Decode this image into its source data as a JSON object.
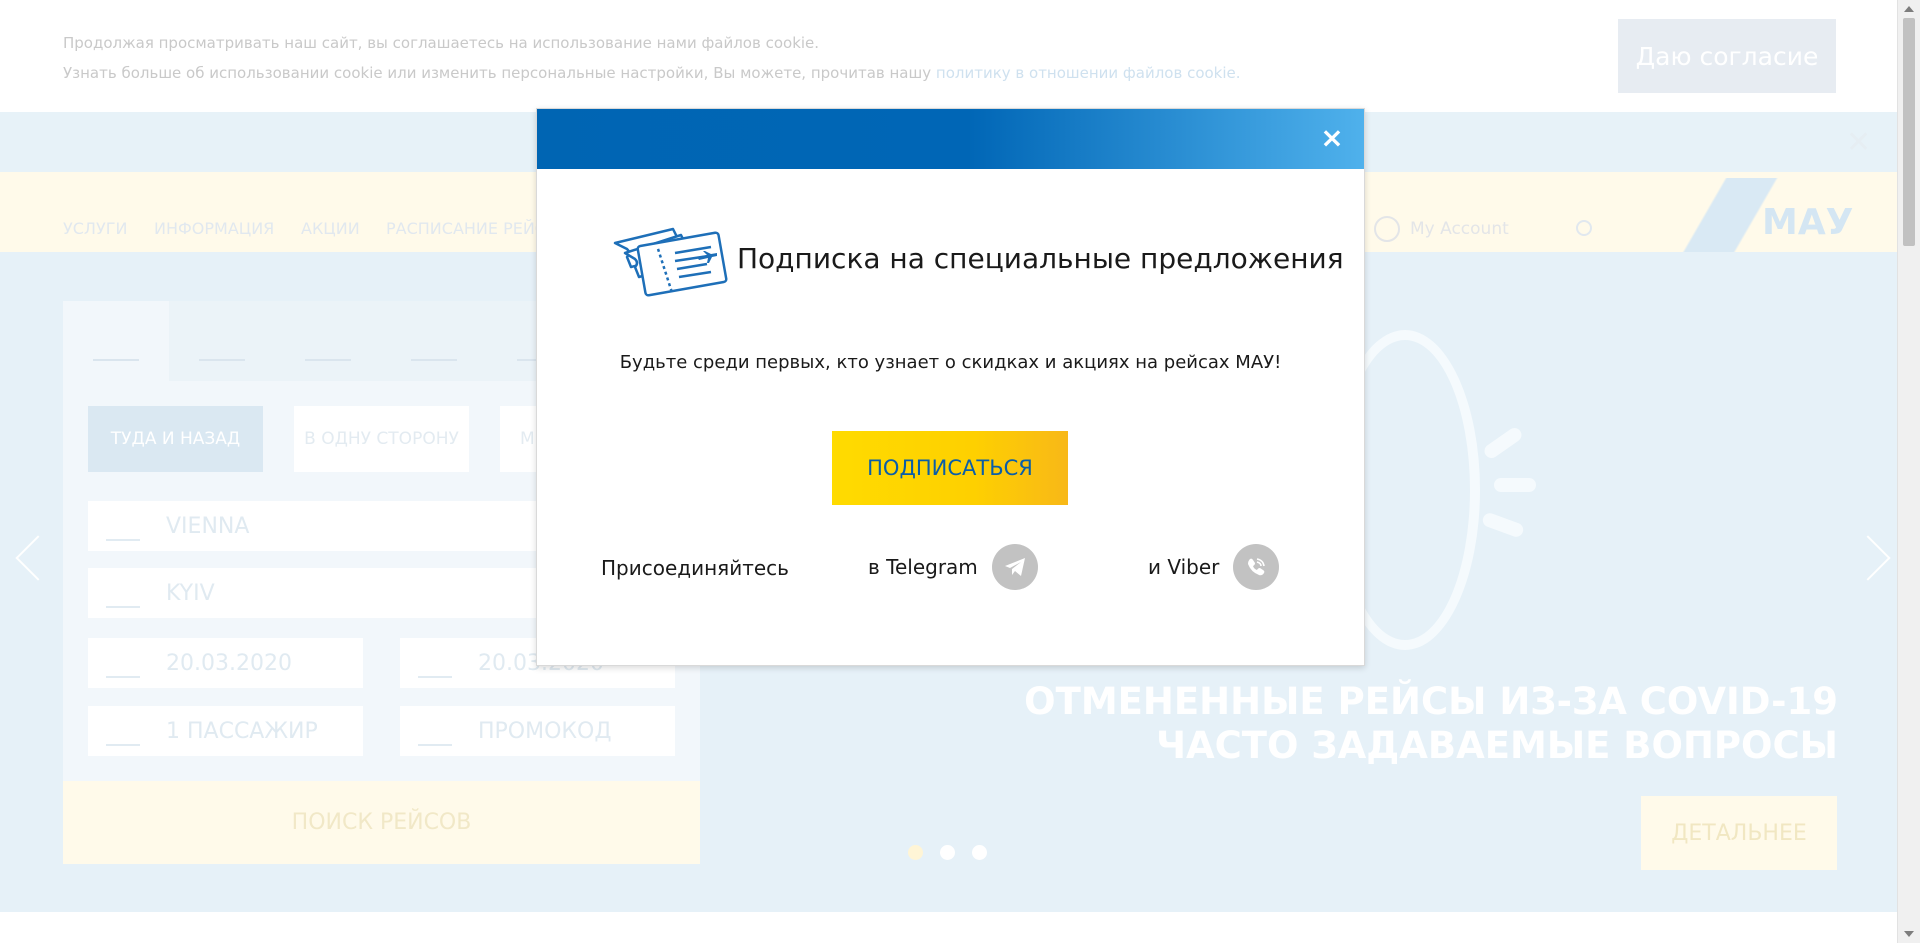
{
  "cookie": {
    "line1": "Продолжая просматривать наш сайт, вы соглашаетесь на использование нами файлов cookie.",
    "line2_prefix": "Узнать больше об использовании cookie или изменить персональные настройки, Вы можете, прочитав нашу",
    "line2_link": "политику в отношении файлов cookie.",
    "consent_button": "Даю согласие"
  },
  "nav": {
    "items": [
      "УСЛУГИ",
      "ИНФОРМАЦИЯ",
      "АКЦИИ",
      "РАСПИСАНИЕ РЕЙСОВ"
    ],
    "account_label": "My Account",
    "logo_text": "МАУ"
  },
  "booking": {
    "tabs": [
      "flights",
      "meals",
      "luggage",
      "car-rental",
      "insurance"
    ],
    "trip_types": [
      "ТУДА И НАЗАД",
      "В ОДНУ СТОРОНУ",
      "М"
    ],
    "from": "VIENNA",
    "to": "KYIV",
    "depart_date": "20.03.2020",
    "return_date": "20.03.2020",
    "passengers": "1 ПАССАЖИР",
    "promo_placeholder": "ПРОМОКОД",
    "search_button": "ПОИСК РЕЙСОВ"
  },
  "hero": {
    "title_line1": "ОТМЕНЕННЫЕ РЕЙСЫ ИЗ-ЗА COVID-19",
    "title_line2": "ЧАСТО ЗАДАВАЕМЫЕ ВОПРОСЫ",
    "details_button": "ДЕТАЛЬНЕЕ",
    "slide_count": 3,
    "active_slide": 1
  },
  "modal": {
    "close_glyph": "×",
    "title": "Подписка на специальные предложения",
    "subtitle": "Будьте среди первых, кто узнает о скидках и акциях на рейсах МАУ!",
    "subscribe_button": "ПОДПИСАТЬСЯ",
    "join_label": "Присоединяйтесь",
    "telegram_label": "в Telegram",
    "viber_label": "и Viber",
    "header_gradient": [
      "#0065b3",
      "#4fb1ec"
    ],
    "button_gradient": [
      "#ffdb00",
      "#f8b818"
    ],
    "button_text_color": "#0a5ea8"
  }
}
